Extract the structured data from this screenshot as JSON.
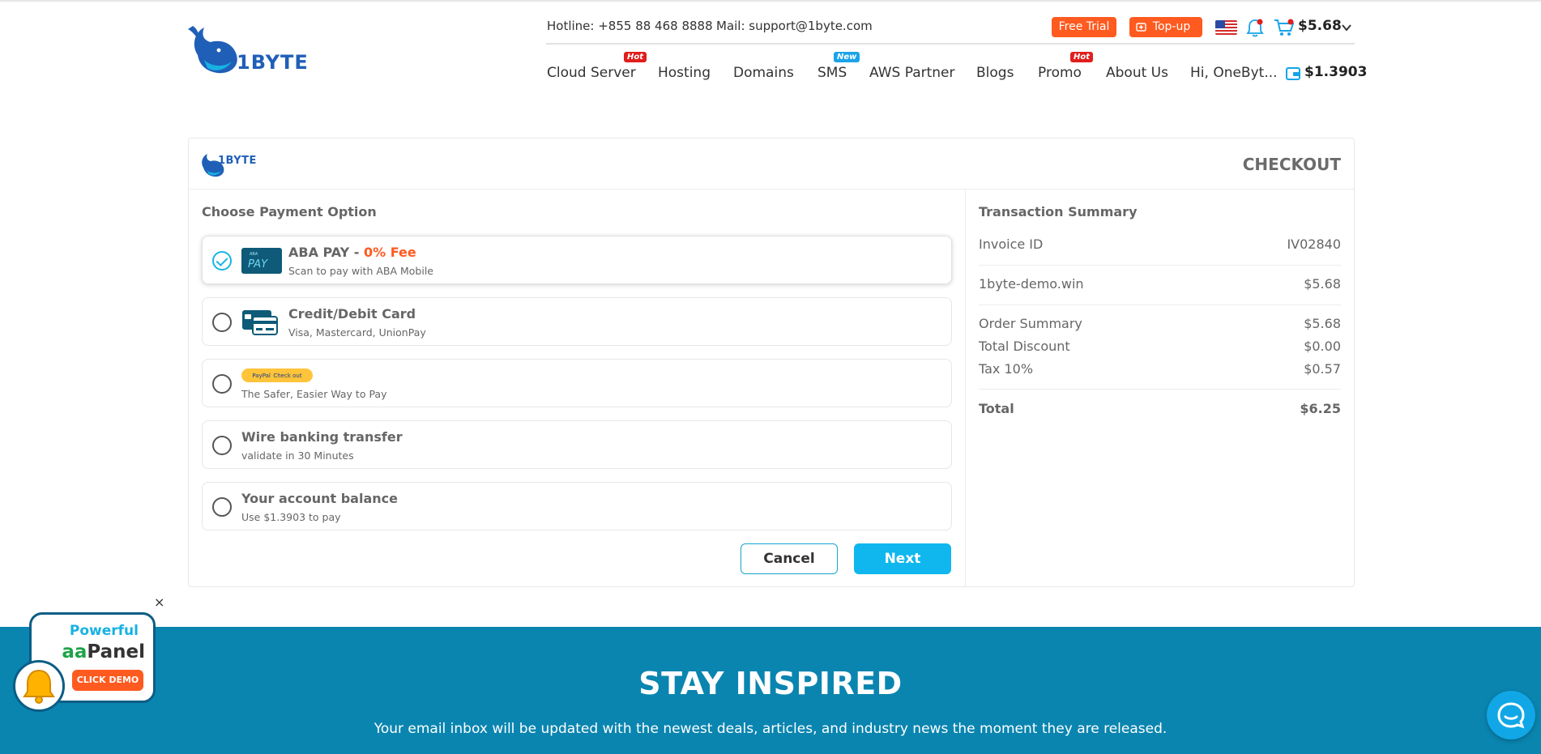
{
  "header": {
    "logo_text": "1BYTE",
    "hotline": "Hotline: +855 88 468 8888",
    "mail": "Mail: support@1byte.com",
    "free_trial": "Free Trial",
    "topup": "Top-up",
    "cart_total": "$5.68",
    "nav": [
      {
        "label": "Cloud Server",
        "badge": "Hot"
      },
      {
        "label": "Hosting",
        "badge": ""
      },
      {
        "label": "Domains",
        "badge": ""
      },
      {
        "label": "SMS",
        "badge": "New"
      },
      {
        "label": "AWS Partner",
        "badge": ""
      },
      {
        "label": "Blogs",
        "badge": ""
      },
      {
        "label": "Promo",
        "badge": "Hot"
      },
      {
        "label": "About Us",
        "badge": ""
      },
      {
        "label": "Hi, OneByt...",
        "badge": ""
      }
    ],
    "wallet_balance": "$1.3903"
  },
  "checkout": {
    "logo_text": "1BYTE",
    "title": "CHECKOUT",
    "payment_title": "Choose Payment Option",
    "options": [
      {
        "title": "ABA PAY - ",
        "fee": "0% Fee",
        "sub": "Scan to pay with ABA Mobile",
        "icon": "aba-pay-icon",
        "selected": true
      },
      {
        "title": "Credit/Debit Card",
        "fee": "",
        "sub": "Visa, Mastercard, UnionPay",
        "icon": "credit-card-icon",
        "selected": false
      },
      {
        "title": "PayPal",
        "fee": "",
        "button_caption": "Check out",
        "sub": "The Safer, Easier Way to Pay",
        "icon": "paypal-icon",
        "selected": false
      },
      {
        "title": "Wire banking transfer",
        "fee": "",
        "sub": "validate in 30 Minutes",
        "icon": "",
        "selected": false
      },
      {
        "title": "Your account balance",
        "fee": "",
        "sub": "Use $1.3903 to pay",
        "icon": "",
        "selected": false
      }
    ],
    "cancel_label": "Cancel",
    "next_label": "Next",
    "summary": {
      "title": "Transaction Summary",
      "invoice_label": "Invoice ID",
      "invoice_value": "IV02840",
      "domain_label": "1byte-demo.win",
      "domain_value": "$5.68",
      "order_label": "Order Summary",
      "order_value": "$5.68",
      "discount_label": "Total Discount",
      "discount_value": "$0.00",
      "tax_label": "Tax 10%",
      "tax_value": "$0.57",
      "total_label": "Total",
      "total_value": "$6.25"
    }
  },
  "footer": {
    "title": "STAY INSPIRED",
    "subtitle": "Your email inbox will be updated with the newest deals, articles, and industry news the moment they are released."
  },
  "promo": {
    "line1": "Powerful",
    "line2_aa": "aa",
    "line2_rest": "Panel",
    "cta": "CLICK DEMO",
    "close": "×"
  },
  "colors": {
    "accent": "#0fb7ee",
    "orange": "#ff5a1f",
    "band": "#0a85b0",
    "brand": "#1f5fb8"
  }
}
